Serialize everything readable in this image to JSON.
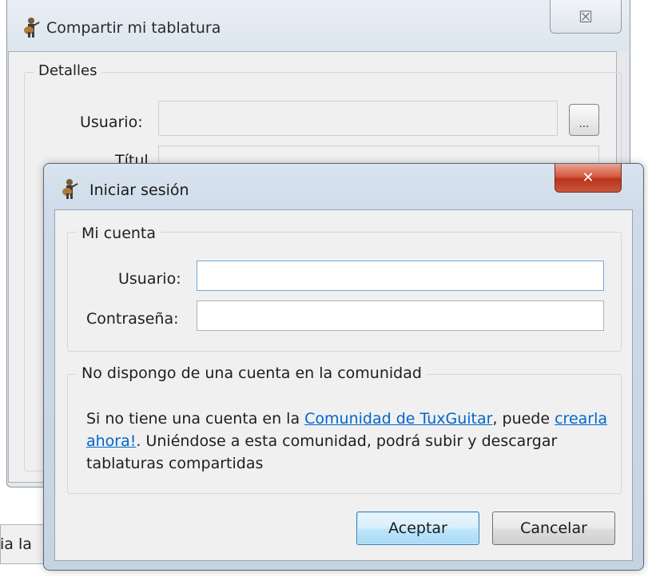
{
  "background_window": {
    "title": "Compartir mi tablatura",
    "close_glyph": "☒",
    "icon": "guitar-player-icon",
    "group_title": "Detalles",
    "user_label": "Usuario:",
    "browse_label": "...",
    "title_label": "Títul",
    "status_text": "ia la"
  },
  "login_dialog": {
    "title": "Iniciar sesión",
    "close_glyph": "✕",
    "icon": "guitar-player-icon",
    "account_group": {
      "title": "Mi cuenta",
      "username_label": "Usuario:",
      "username_value": "",
      "password_label": "Contraseña:",
      "password_value": ""
    },
    "community_group": {
      "title": "No dispongo de una cuenta en la comunidad",
      "text_before_link": "Si no tiene una cuenta en la ",
      "community_link": "Comunidad de TuxGuitar",
      "text_middle": ", puede ",
      "register_link": "crearla ahora!",
      "text_after": ". Uniéndose a esta comunidad, podrá subir y descargar tablaturas compartidas"
    },
    "buttons": {
      "accept": "Aceptar",
      "cancel": "Cancelar"
    }
  },
  "colors": {
    "link": "#0066cc",
    "close_button_red": "#c9583c",
    "focus_blue": "#6fa8dc"
  }
}
